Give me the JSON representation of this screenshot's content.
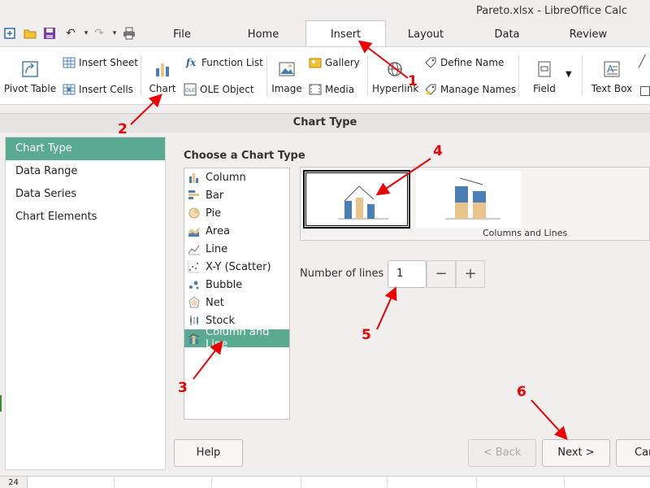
{
  "window": {
    "title": "Pareto.xlsx - LibreOffice Calc"
  },
  "tabs": [
    "File",
    "Home",
    "Insert",
    "Layout",
    "Data",
    "Review"
  ],
  "ribbon": {
    "pivot_table": "Pivot Table",
    "insert_sheet": "Insert Sheet",
    "insert_cells": "Insert Cells",
    "chart": "Chart",
    "function_list": "Function List",
    "ole_object": "OLE Object",
    "image": "Image",
    "gallery": "Gallery",
    "media": "Media",
    "hyperlink": "Hyperlink",
    "define_name": "Define Name",
    "manage_names": "Manage Names",
    "field": "Field",
    "text_box": "Text Box"
  },
  "dialog": {
    "title": "Chart Type",
    "nav": [
      "Chart Type",
      "Data Range",
      "Data Series",
      "Chart Elements"
    ],
    "choose_label": "Choose a Chart Type",
    "types": [
      "Column",
      "Bar",
      "Pie",
      "Area",
      "Line",
      "X-Y (Scatter)",
      "Bubble",
      "Net",
      "Stock",
      "Column and Line"
    ],
    "selected_type": "Column and Line",
    "variant_caption": "Columns and Lines",
    "lines_label": "Number of lines",
    "lines_value": "1",
    "minus": "−",
    "plus": "+",
    "buttons": {
      "help": "Help",
      "back": "< Back",
      "next": "Next >",
      "cancel": "Car"
    }
  },
  "sheet": {
    "row_number": "24"
  },
  "annotations": [
    "1",
    "2",
    "3",
    "4",
    "5",
    "6"
  ],
  "colors": {
    "accent": "#5aaa91",
    "arrow": "#e00000",
    "column_blue": "#4a7fb5",
    "column_tan": "#e8c48a"
  }
}
